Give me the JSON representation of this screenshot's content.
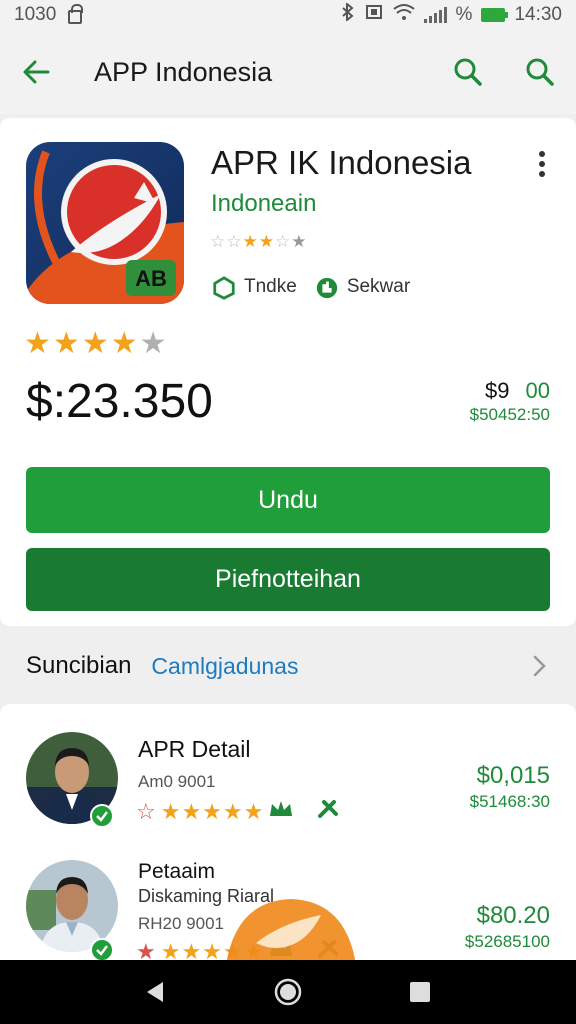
{
  "status_bar": {
    "time_left": "1030",
    "time_right": "14:30",
    "battery_label": "%"
  },
  "app_bar": {
    "title": "APP Indonesia"
  },
  "app": {
    "name": "APR IK Indonesia",
    "developer": "Indoneain",
    "tag1": "Tndke",
    "tag2": "Sekwar",
    "small_rating": 3,
    "rating": 4,
    "price": "$:23.350",
    "side_price_a": "$9",
    "side_price_b": "00",
    "side_price_sub": "$50452:50",
    "logo_text": "AB"
  },
  "buttons": {
    "primary": "Undu",
    "secondary": "Piefnotteihan"
  },
  "section": {
    "title": "Suncibian",
    "link": "Camlgjadunas"
  },
  "items": [
    {
      "title": "APR Detail",
      "subtitle": "",
      "meta": "Am0 9001",
      "price": "$0,015",
      "price_sub": "$51468:30",
      "rating": 5
    },
    {
      "title": "Petaaim",
      "subtitle": "Diskaming Riaral",
      "meta": "RH20 9001",
      "price": "$80.20",
      "price_sub": "$52685100",
      "rating": 5
    }
  ],
  "colors": {
    "green": "#1f9e3a",
    "dark_green": "#197a31",
    "star": "#f2a21b",
    "link_blue": "#1e7bbf"
  }
}
